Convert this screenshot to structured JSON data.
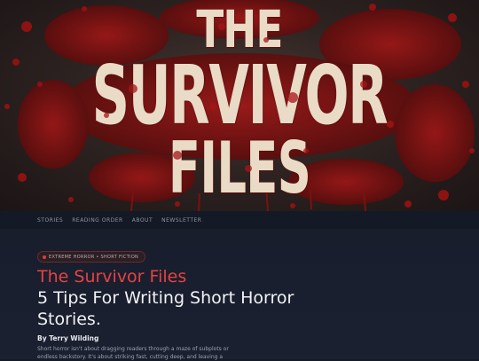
{
  "hero": {
    "line1": "THE",
    "line2": "SURVIVOR",
    "line3": "FILES",
    "colors": {
      "text": "#e9dbc6",
      "blood": "#9b1414",
      "bg": "#2e2422"
    }
  },
  "nav": {
    "items": [
      "STORIES",
      "READING ORDER",
      "ABOUT",
      "NEWSLETTER"
    ]
  },
  "article": {
    "badge": "EXTREME HORROR • SHORT FICTION",
    "series_title": "The Survivor Files",
    "headline": "5 Tips For Writing Short Horror Stories.",
    "byline": "By Terry Wilding",
    "intro": "Short horror isn't about dragging readers through a maze of subplots or endless backstory. It's about striking fast, cutting deep, and leaving a",
    "accent_color": "#e84242"
  }
}
